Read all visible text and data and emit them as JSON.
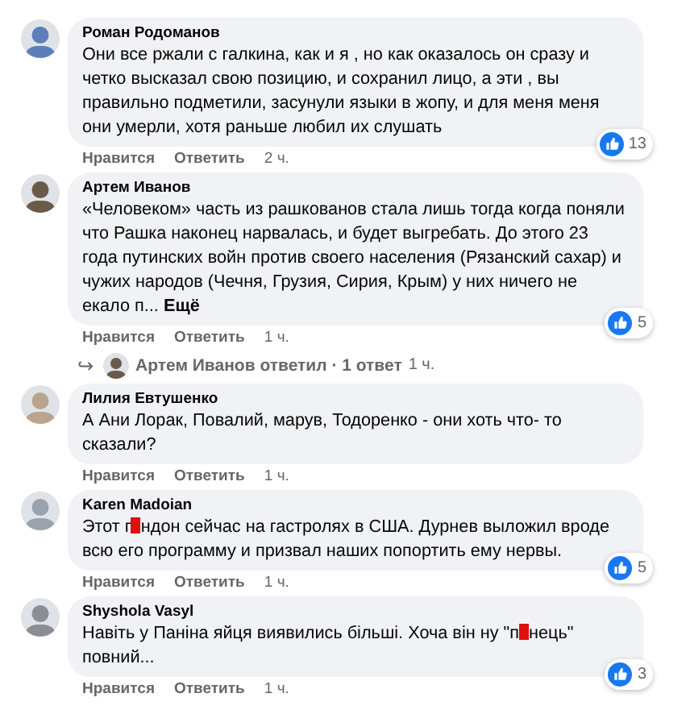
{
  "comments": [
    {
      "author": "Роман Родоманов",
      "text_parts": [
        "Они все ржали с галкина, как и я , но как оказалось он сразу и четко высказал свою позицию, и сохранил лицо, а эти , вы правильно подметили, засунули языки в жопу, и для меня меня они умерли, хотя раньше любил их слушать"
      ],
      "likes": "13",
      "actions": [
        "Нравится",
        "Ответить"
      ],
      "time": "2 ч."
    },
    {
      "author": "Артем Иванов",
      "text_parts": [
        "«Человеком» часть из рашкованов стала лишь тогда когда поняли что Рашка наконец нарвалась, и будет выгребать. До этого 23 года путинских войн против своего населения (Рязанский сахар) и чужих народов (Чечня, Грузия, Сирия, Крым) у них ничего не екало п..."
      ],
      "more": "Ещё",
      "likes": "5",
      "actions": [
        "Нравится",
        "Ответить"
      ],
      "time": "1 ч.",
      "reply": {
        "arrow": "↪",
        "text": "Артем Иванов ответил · 1 ответ",
        "time": "1 ч."
      }
    },
    {
      "author": "Лилия Евтушенко",
      "text_parts": [
        "А Ани Лорак, Повалий, марув, Тодоренко - они хоть что- то сказали?"
      ],
      "actions": [
        "Нравится",
        "Ответить"
      ],
      "time": "1 ч."
    },
    {
      "author": "Karen Madoian",
      "text_parts": [
        "Этот г",
        "ндон сейчас на гастролях в США. Дурнев выложил вроде всю его программу и призвал наших попортить ему нервы."
      ],
      "likes": "5",
      "actions": [
        "Нравится",
        "Ответить"
      ],
      "time": "1 ч."
    },
    {
      "author": "Shyshola Vasyl",
      "text_parts": [
        "Навіть у Паніна яйця виявились більші. Хоча він ну \"п",
        "нець\" повний..."
      ],
      "likes": "3",
      "actions": [
        "Нравится",
        "Ответить"
      ],
      "time": "1 ч."
    }
  ]
}
